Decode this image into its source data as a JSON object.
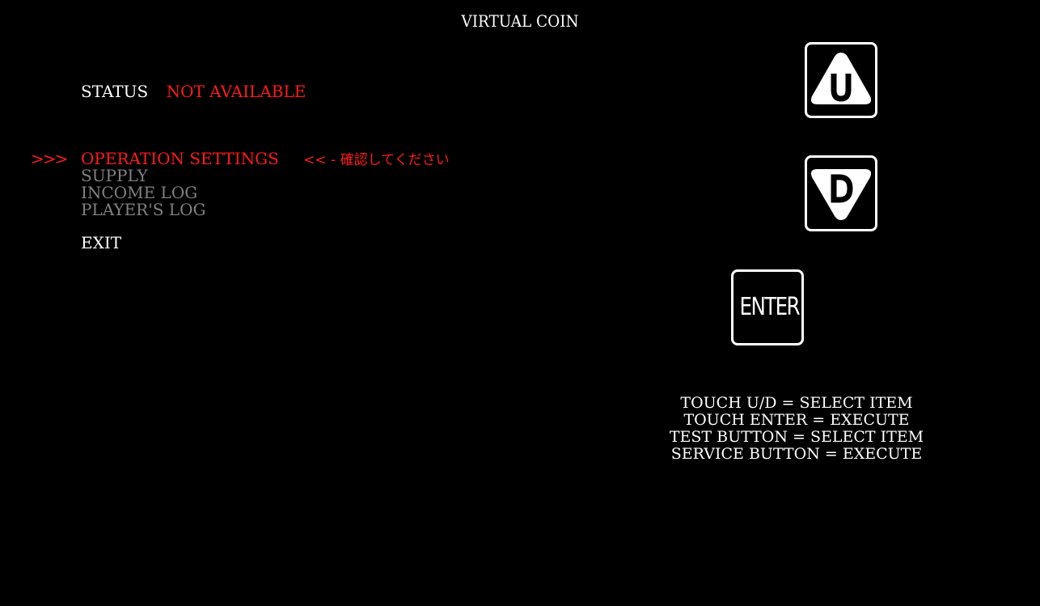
{
  "header": {
    "title": "VIRTUAL COIN"
  },
  "status": {
    "label": "STATUS",
    "value": "NOT AVAILABLE"
  },
  "menu": {
    "cursor": ">>>",
    "items": [
      {
        "label": "OPERATION SETTINGS",
        "state": "selected",
        "note": "<< - 確認してください"
      },
      {
        "label": "SUPPLY",
        "state": "disabled"
      },
      {
        "label": "INCOME LOG",
        "state": "disabled"
      },
      {
        "label": "PLAYER'S LOG",
        "state": "disabled"
      }
    ],
    "exit_label": "EXIT"
  },
  "touch_buttons": {
    "up": {
      "icon": "up-triangle-icon",
      "letter": "U"
    },
    "down": {
      "icon": "down-triangle-icon",
      "letter": "D"
    },
    "enter": {
      "label": "ENTER"
    }
  },
  "help": {
    "lines": [
      "TOUCH U/D = SELECT ITEM",
      "TOUCH ENTER = EXECUTE",
      "TEST BUTTON = SELECT ITEM",
      "SERVICE BUTTON = EXECUTE"
    ]
  },
  "colors": {
    "background": "#000000",
    "text": "#ffffff",
    "highlight": "#ff1a1a",
    "disabled": "#808080"
  }
}
